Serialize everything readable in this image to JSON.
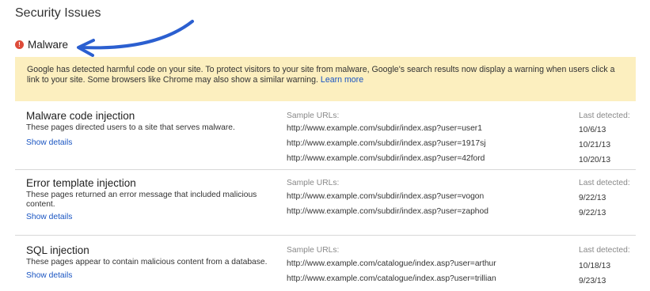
{
  "page": {
    "title": "Security Issues"
  },
  "malware": {
    "heading": "Malware",
    "icon": "alert-icon",
    "warning_text": "Google has detected harmful code on your site. To protect visitors to your site from malware, Google's search results now display a warning when users click a link to your site. Some browsers like Chrome may also show a similar warning.",
    "learn_more": "Learn more"
  },
  "columns": {
    "sample_urls": "Sample URLs:",
    "last_detected": "Last detected:"
  },
  "issues": [
    {
      "title": "Malware code injection",
      "description": "These pages directed users to a site that serves malware.",
      "show_details": "Show details",
      "rows": [
        {
          "url": "http://www.example.com/subdir/index.asp?user=user1",
          "date": "10/6/13"
        },
        {
          "url": "http://www.example.com/subdir/index.asp?user=1917sj",
          "date": "10/21/13"
        },
        {
          "url": "http://www.example.com/subdir/index.asp?user=42ford",
          "date": "10/20/13"
        }
      ]
    },
    {
      "title": "Error template injection",
      "description": "These pages returned an error message that included malicious content.",
      "show_details": "Show details",
      "rows": [
        {
          "url": "http://www.example.com/subdir/index.asp?user=vogon",
          "date": "9/22/13"
        },
        {
          "url": "http://www.example.com/subdir/index.asp?user=zaphod",
          "date": "9/22/13"
        }
      ]
    },
    {
      "title": "SQL injection",
      "description": "These pages appear to contain malicious content from a database.",
      "show_details": "Show details",
      "rows": [
        {
          "url": "http://www.example.com/catalogue/index.asp?user=arthur",
          "date": "10/18/13"
        },
        {
          "url": "http://www.example.com/catalogue/index.asp?user=trillian",
          "date": "9/23/13"
        }
      ]
    }
  ],
  "colors": {
    "accent_blue": "#2b5fd0",
    "warning_bg": "#fcefbf",
    "alert_red": "#dd4b39"
  }
}
